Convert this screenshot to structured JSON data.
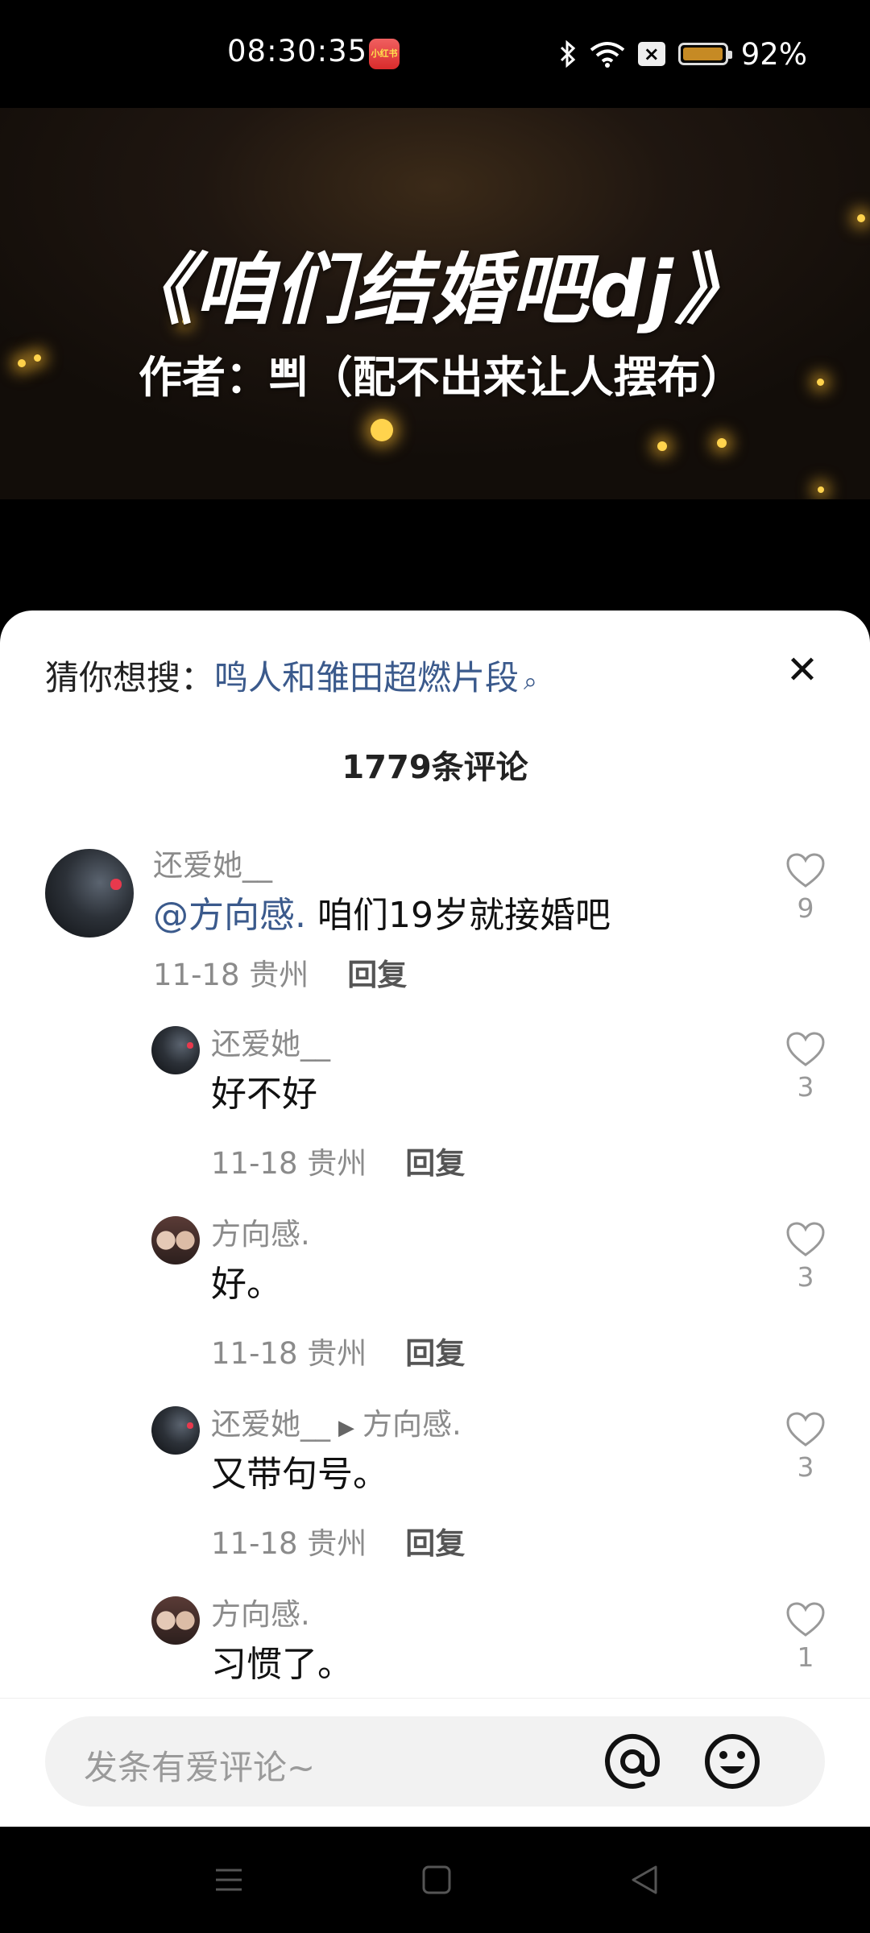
{
  "status_bar": {
    "time": "08:30:35",
    "battery_percent": "92%",
    "app_badge": "小红书",
    "icons": [
      "bluetooth-icon",
      "wifi-icon",
      "sim-off-icon",
      "battery-icon"
    ]
  },
  "video": {
    "title": "《咱们结婚吧dj》",
    "author": "作者：쁴（配不出来让人摆布）"
  },
  "sheet": {
    "suggest_label": "猜你想搜：",
    "suggest_keyword": "鸣人和雏田超燃片段",
    "comment_count": "1779条评论"
  },
  "comments": [
    {
      "user": "还爱她__",
      "mention": "@方向感.",
      "text": " 咱们19岁就接婚吧",
      "date": "11-18",
      "location": "贵州",
      "reply": "回复",
      "likes": "9"
    },
    {
      "user": "还爱她__",
      "text": "好不好",
      "date": "11-18",
      "location": "贵州",
      "reply": "回复",
      "likes": "3"
    },
    {
      "user": "方向感.",
      "text": "好。",
      "date": "11-18",
      "location": "贵州",
      "reply": "回复",
      "likes": "3"
    },
    {
      "user": "还爱她__",
      "reply_to": "方向感.",
      "text": "又带句号。",
      "date": "11-18",
      "location": "贵州",
      "reply": "回复",
      "likes": "3"
    },
    {
      "user": "方向感.",
      "text": "习惯了。",
      "likes": "1"
    }
  ],
  "input": {
    "placeholder": "发条有爱评论~"
  },
  "colors": {
    "accent_link": "#3b5a8c",
    "muted_text": "#8b8b8b"
  }
}
